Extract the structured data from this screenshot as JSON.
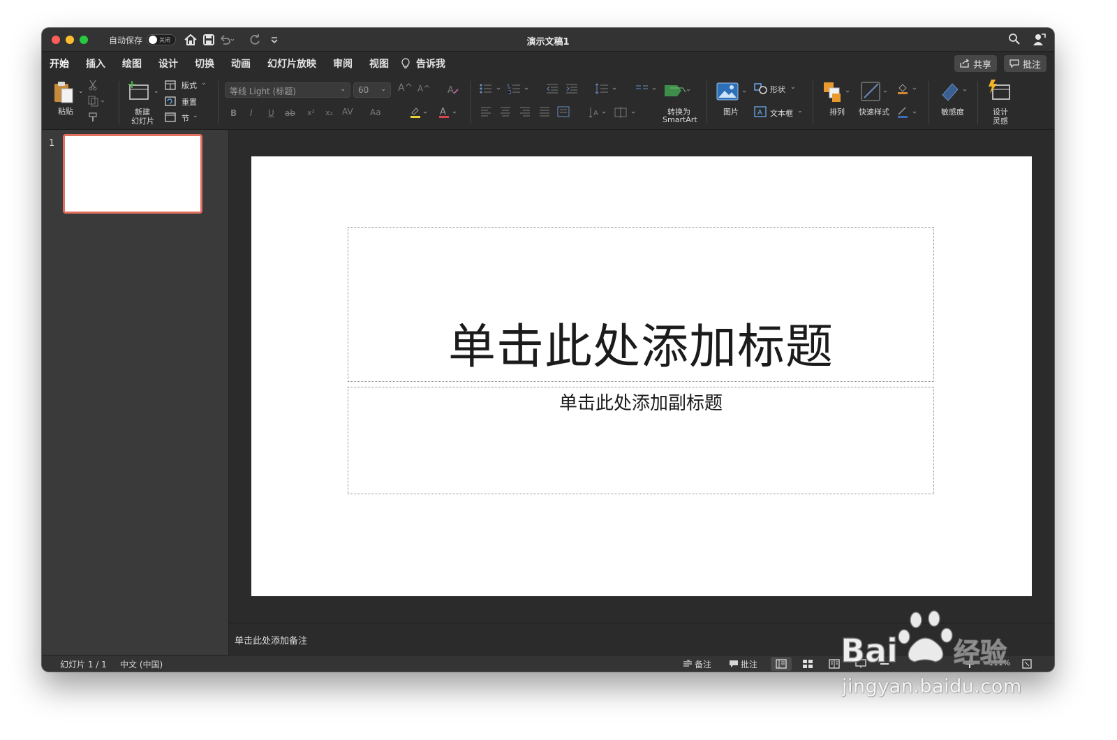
{
  "window": {
    "title": "演示文稿1",
    "autosave_label": "自动保存",
    "autosave_state": "关闭"
  },
  "tabs": [
    {
      "label": "开始",
      "active": true
    },
    {
      "label": "插入"
    },
    {
      "label": "绘图"
    },
    {
      "label": "设计"
    },
    {
      "label": "切换"
    },
    {
      "label": "动画"
    },
    {
      "label": "幻灯片放映"
    },
    {
      "label": "审阅"
    },
    {
      "label": "视图"
    },
    {
      "label": "告诉我"
    }
  ],
  "header_buttons": {
    "share": "共享",
    "comments": "批注"
  },
  "ribbon": {
    "paste": "粘贴",
    "new_slide": [
      "新建",
      "幻灯片"
    ],
    "layout": "版式",
    "reset": "重置",
    "section": "节",
    "font_name": "等线 Light (标题)",
    "font_size": "60",
    "bold": "B",
    "italic": "I",
    "underline": "U",
    "strike": "ab",
    "superscript": "x²",
    "subscript": "x₂",
    "char_spacing": "AV",
    "change_case": "Aa",
    "grow_font": "A^",
    "shrink_font": "A^",
    "smartart": [
      "转换为",
      "SmartArt"
    ],
    "picture": "图片",
    "shape": "形状",
    "textbox": "文本框",
    "arrange": "排列",
    "quick_styles": "快速样式",
    "sensitivity": "敏感度",
    "designer": [
      "设计",
      "灵感"
    ]
  },
  "slides_panel": {
    "slide_number": "1"
  },
  "slide": {
    "title_placeholder": "单击此处添加标题",
    "subtitle_placeholder": "单击此处添加副标题"
  },
  "notes": {
    "placeholder": "单击此处添加备注"
  },
  "statusbar": {
    "slide_info": "幻灯片 1 / 1",
    "language": "中文 (中国)",
    "notes_btn": "备注",
    "comments_btn": "批注",
    "zoom": "111%"
  },
  "watermark": {
    "brand_a": "Bai",
    "brand_b": "经验",
    "url": "jingyan.baidu.com"
  },
  "colors": {
    "accent_thumb_border": "#e2705f",
    "window_bg": "#2b2b2b",
    "panel_bg": "#3a3a3a"
  }
}
